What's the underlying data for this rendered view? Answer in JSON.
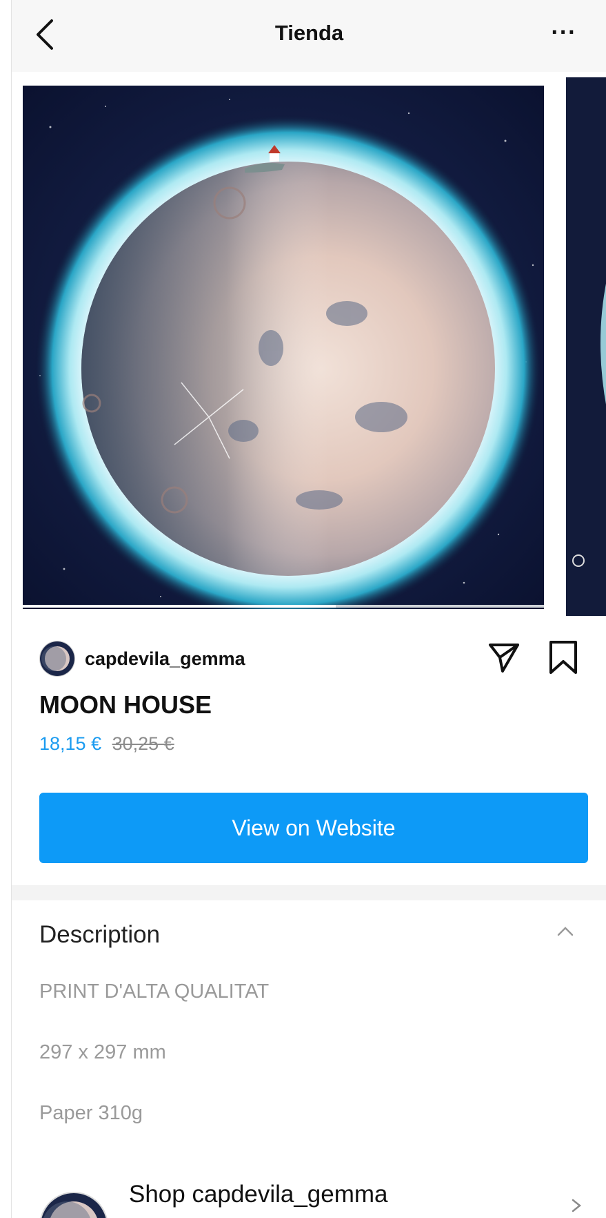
{
  "header": {
    "title": "Tienda",
    "back_icon": "chevron-left-icon",
    "more_icon": "more-horizontal-icon",
    "more_label": "···"
  },
  "carousel": {
    "slide_count": 2,
    "progress": 0.6
  },
  "product": {
    "seller": "capdevila_gemma",
    "title": "MOON HOUSE",
    "price_sale": "18,15 €",
    "price_original": "30,25 €",
    "share_icon": "send-icon",
    "save_icon": "bookmark-icon",
    "cta_label": "View on Website"
  },
  "description": {
    "heading": "Description",
    "collapse_icon": "chevron-up-icon",
    "lines": [
      "PRINT D'ALTA QUALITAT",
      "297 x 297 mm",
      "Paper 310g"
    ]
  },
  "shop": {
    "label": "Shop capdevila_gemma",
    "chevron_icon": "chevron-right-icon"
  },
  "colors": {
    "accent": "#0d9af7",
    "sale_price": "#1a9bf0",
    "muted": "#9a9a9a"
  }
}
